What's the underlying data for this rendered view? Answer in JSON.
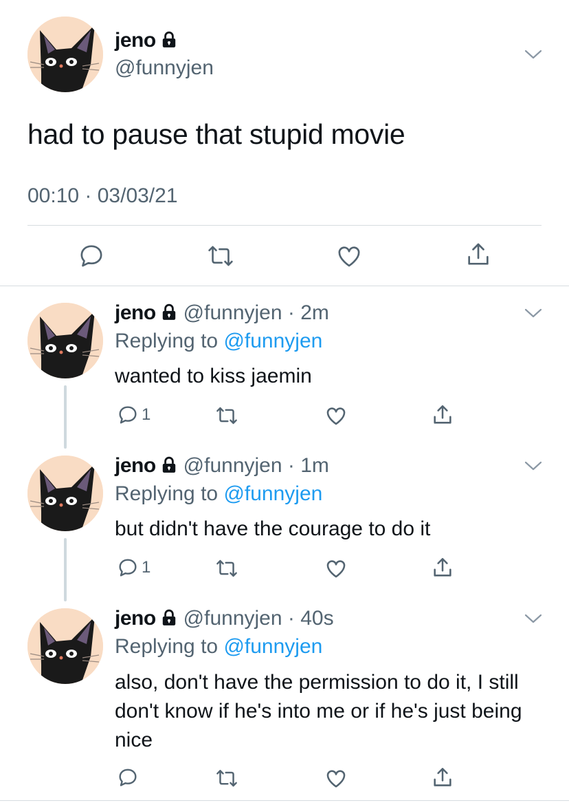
{
  "colors": {
    "text": "#0f1419",
    "secondary": "#536471",
    "link": "#1d9bf0",
    "divider": "#d6dce0"
  },
  "main_tweet": {
    "name": "jeno",
    "handle": "@funnyjen",
    "text": "had to pause that stupid movie",
    "timestamp": "00:10 · 03/03/21",
    "icons": [
      "reply-icon",
      "retweet-icon",
      "like-icon",
      "share-icon"
    ]
  },
  "replies": [
    {
      "name": "jeno",
      "handle_time": "@funnyjen · 2m",
      "replying_label": "Replying to",
      "replying_mention": "@funnyjen",
      "text": "wanted to kiss jaemin",
      "reply_count": "1"
    },
    {
      "name": "jeno",
      "handle_time": "@funnyjen · 1m",
      "replying_label": "Replying to",
      "replying_mention": "@funnyjen",
      "text": "but didn't have the courage to do it",
      "reply_count": "1"
    },
    {
      "name": "jeno",
      "handle_time": "@funnyjen · 40s",
      "replying_label": "Replying to",
      "replying_mention": "@funnyjen",
      "text": "also, don't have the permission to do it, I still don't know if he's into me or if he's just being nice",
      "reply_count": ""
    }
  ]
}
